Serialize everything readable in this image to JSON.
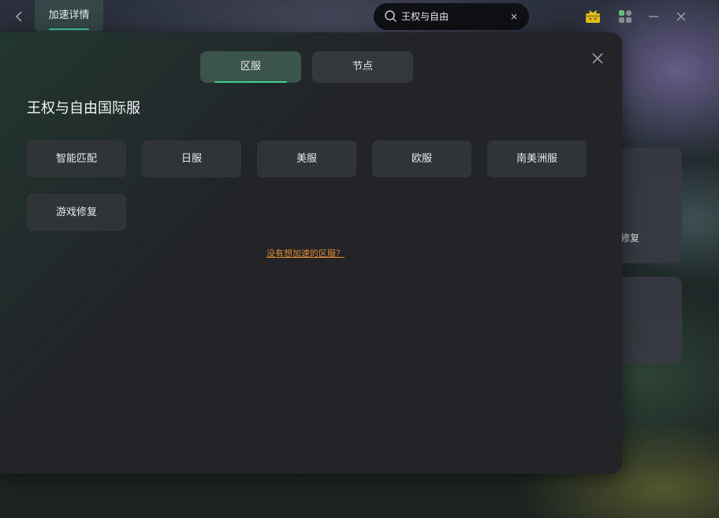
{
  "topbar": {
    "tab_label": "加速详情",
    "search_value": "王权与自由",
    "search_clear": "×",
    "back_icon": "chevron-left-icon",
    "icons": [
      "gift-icon",
      "apps-icon",
      "minimize-icon",
      "close-icon"
    ]
  },
  "background_cards": {
    "card1_text": "修复"
  },
  "modal": {
    "tabs": [
      {
        "label": "区服",
        "active": true
      },
      {
        "label": "节点",
        "active": false
      }
    ],
    "game_title": "王权与自由国际服",
    "regions": [
      "智能匹配",
      "日服",
      "美服",
      "欧服",
      "南美洲服",
      "游戏修复"
    ],
    "help_link": "没有想加速的区服？"
  },
  "colors": {
    "accent": "#3ccf8e",
    "link": "#e08a2e",
    "panel": "#222428",
    "button": "#303437"
  }
}
